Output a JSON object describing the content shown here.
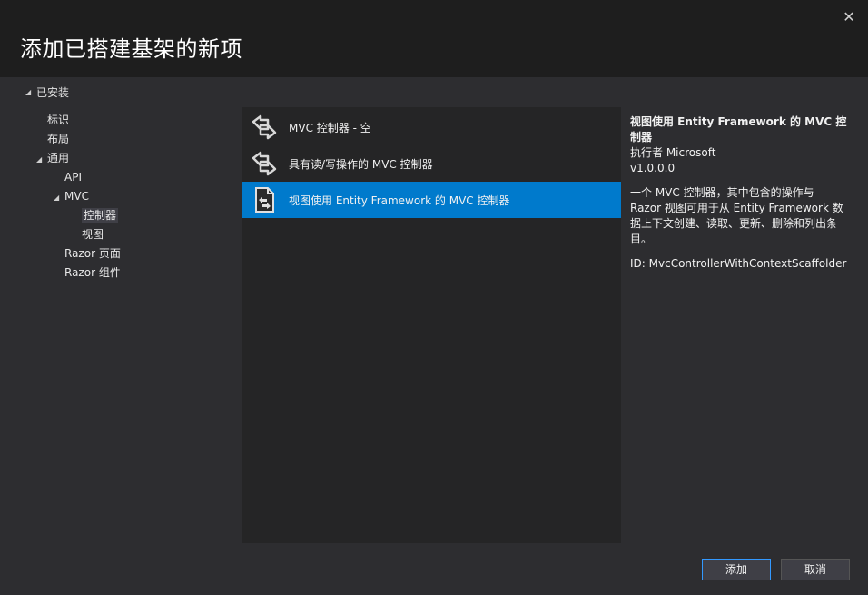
{
  "dialog": {
    "title": "添加已搭建基架的新项",
    "close_icon": "close-icon"
  },
  "tree": {
    "root_label": "已安装",
    "items": [
      {
        "label": "标识",
        "indent": 0,
        "expander": ""
      },
      {
        "label": "布局",
        "indent": 0,
        "expander": ""
      },
      {
        "label": "通用",
        "indent": 0,
        "expander": "▲"
      },
      {
        "label": "API",
        "indent": 1,
        "expander": ""
      },
      {
        "label": "MVC",
        "indent": 1,
        "expander": "▲"
      },
      {
        "label": "控制器",
        "indent": 2,
        "expander": "",
        "selected": true
      },
      {
        "label": "视图",
        "indent": 2,
        "expander": ""
      },
      {
        "label": "Razor 页面",
        "indent": 1,
        "expander": ""
      },
      {
        "label": "Razor 组件",
        "indent": 1,
        "expander": ""
      }
    ]
  },
  "templates": [
    {
      "label": "MVC 控制器 - 空",
      "icon": "controller-icon"
    },
    {
      "label": "具有读/写操作的 MVC 控制器",
      "icon": "controller-icon"
    },
    {
      "label": "视图使用 Entity Framework 的 MVC 控制器",
      "icon": "document-controller-icon",
      "selected": true
    }
  ],
  "details": {
    "title": "视图使用 Entity Framework 的 MVC 控制器",
    "author": "执行者 Microsoft",
    "version": "v1.0.0.0",
    "description": "一个 MVC 控制器，其中包含的操作与 Razor 视图可用于从 Entity Framework 数据上下文创建、读取、更新、删除和列出条目。",
    "id": "ID: MvcControllerWithContextScaffolder"
  },
  "buttons": {
    "add": "添加",
    "cancel": "取消"
  },
  "colors": {
    "accent": "#007acc",
    "background": "#2d2d30",
    "header": "#1e1e1e",
    "list_bg": "#252526"
  }
}
